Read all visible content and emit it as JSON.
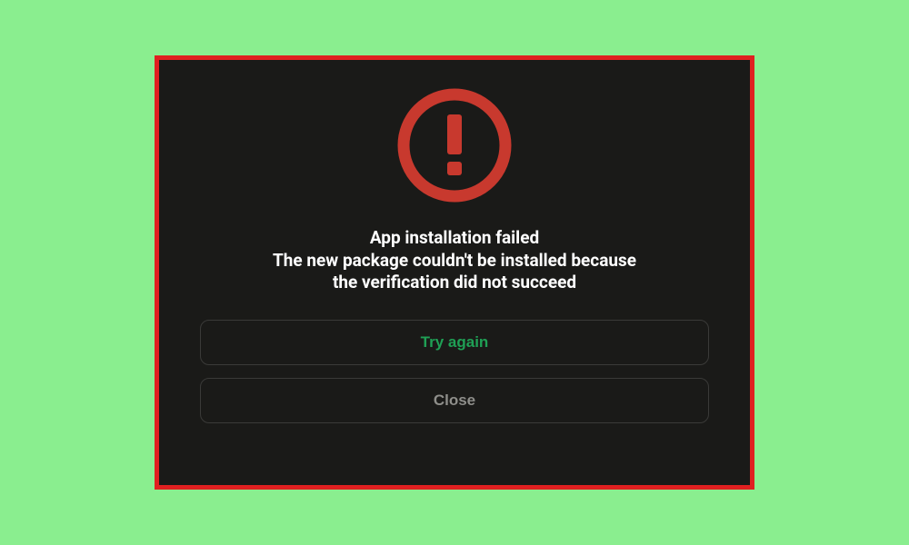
{
  "colors": {
    "page_bg": "#8aee8f",
    "frame_border": "#e02020",
    "dialog_bg": "#1a1a18",
    "icon_ring": "#c8392e",
    "primary_button_text": "#1fa055",
    "secondary_button_text": "#8e8e8a"
  },
  "icon": {
    "name": "alert-circle-icon"
  },
  "message": {
    "title": "App installation failed",
    "line1": "The new package couldn't be installed because",
    "line2": "the verification did not succeed"
  },
  "buttons": {
    "primary_label": "Try again",
    "secondary_label": "Close"
  }
}
